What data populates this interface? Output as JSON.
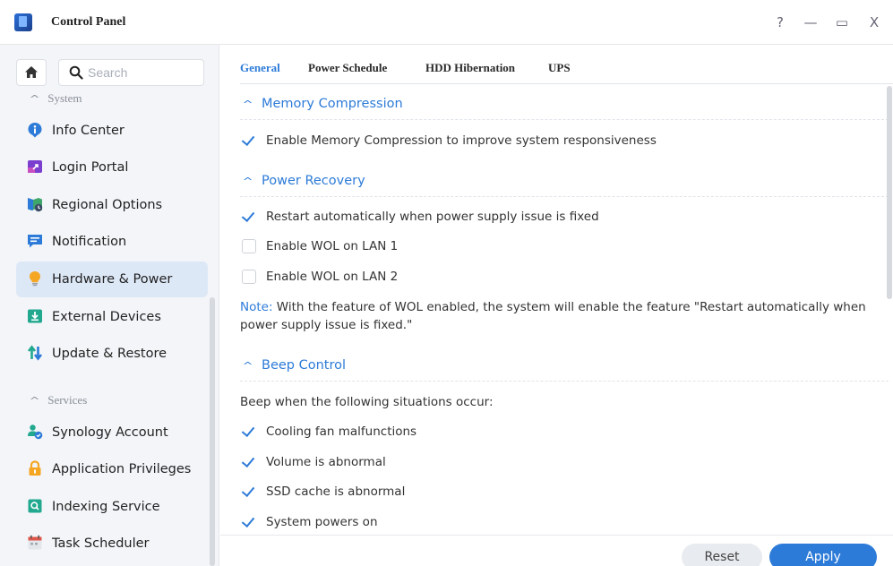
{
  "window": {
    "title": "Control Panel",
    "controls": {
      "help": "?",
      "minimize": "—",
      "maximize": "▭",
      "close": "X"
    }
  },
  "sidebar": {
    "search_placeholder": "Search",
    "sections": [
      {
        "label": "System"
      },
      {
        "label": "Services"
      }
    ],
    "items": [
      {
        "label": "Info Center",
        "icon": "info-icon"
      },
      {
        "label": "Login Portal",
        "icon": "login-portal-icon"
      },
      {
        "label": "Regional Options",
        "icon": "regional-options-icon"
      },
      {
        "label": "Notification",
        "icon": "notification-icon"
      },
      {
        "label": "Hardware & Power",
        "icon": "lightbulb-icon",
        "active": true
      },
      {
        "label": "External Devices",
        "icon": "external-devices-icon"
      },
      {
        "label": "Update & Restore",
        "icon": "update-restore-icon"
      },
      {
        "label": "Synology Account",
        "icon": "synology-account-icon"
      },
      {
        "label": "Application Privileges",
        "icon": "lock-icon"
      },
      {
        "label": "Indexing Service",
        "icon": "indexing-icon"
      },
      {
        "label": "Task Scheduler",
        "icon": "calendar-icon"
      }
    ]
  },
  "tabs": [
    {
      "label": "General",
      "active": true
    },
    {
      "label": "Power Schedule"
    },
    {
      "label": "HDD Hibernation"
    },
    {
      "label": "UPS"
    }
  ],
  "memory": {
    "title": "Memory Compression",
    "options": [
      {
        "label": "Enable Memory Compression to improve system responsiveness",
        "checked": true
      }
    ]
  },
  "power_recovery": {
    "title": "Power Recovery",
    "options": [
      {
        "label": "Restart automatically when power supply issue is fixed",
        "checked": true
      },
      {
        "label": "Enable WOL on LAN 1",
        "checked": false
      },
      {
        "label": "Enable WOL on LAN 2",
        "checked": false
      }
    ],
    "note_key": "Note:",
    "note_text": " With the feature of WOL enabled, the system will enable the feature \"Restart automatically when power supply issue is fixed.\""
  },
  "beep": {
    "title": "Beep Control",
    "description": "Beep when the following situations occur:",
    "options": [
      {
        "label": "Cooling fan malfunctions",
        "checked": true
      },
      {
        "label": "Volume is abnormal",
        "checked": true
      },
      {
        "label": "SSD cache is abnormal",
        "checked": true
      },
      {
        "label": "System powers on",
        "checked": true
      }
    ]
  },
  "footer": {
    "reset_label": "Reset",
    "apply_label": "Apply"
  },
  "colors": {
    "accent": "#2d7bd8",
    "active_bg": "#dde8f7",
    "sidebar_bg": "#f3f5f8"
  }
}
